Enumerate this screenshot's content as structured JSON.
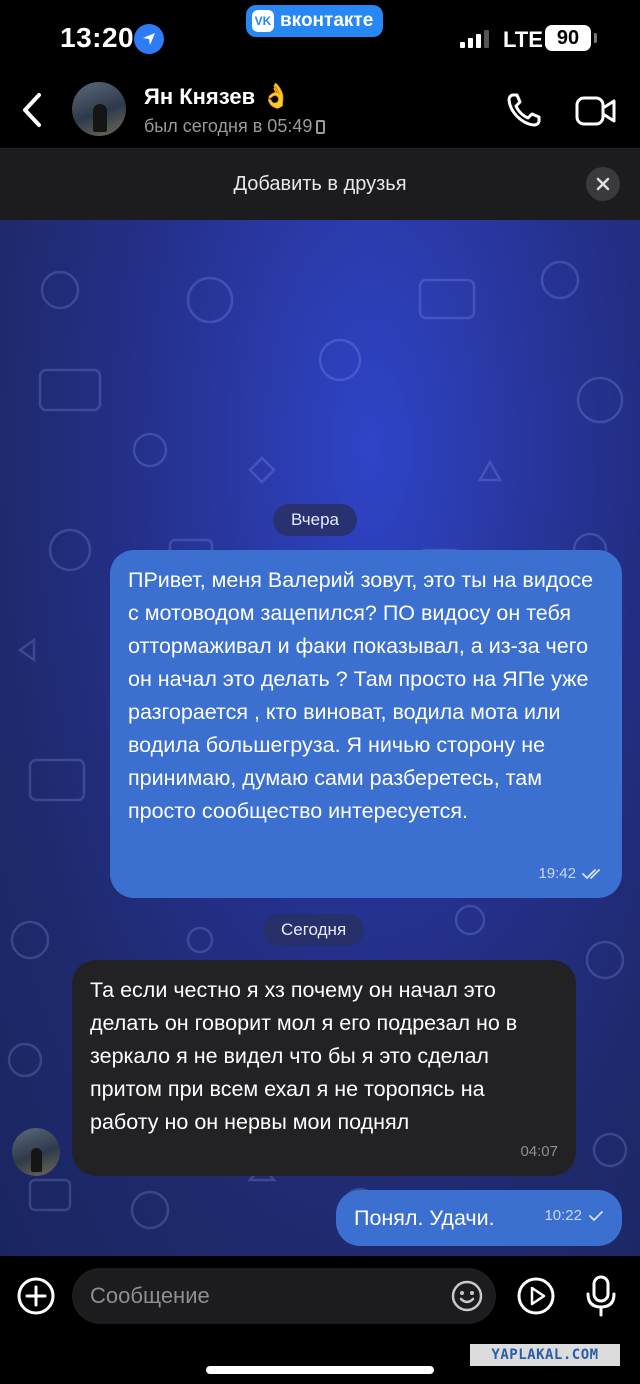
{
  "status_bar": {
    "time": "13:20",
    "app_badge": "вконтакте",
    "app_badge_logo": "VK",
    "network": "LTE",
    "battery": "90"
  },
  "header": {
    "name": "Ян Князев",
    "name_emoji": "👌",
    "last_seen": "был сегодня в 05:49"
  },
  "friend_bar": {
    "label": "Добавить в друзья"
  },
  "messages": [
    {
      "type": "date",
      "label": "Вчера"
    },
    {
      "type": "outgoing",
      "text": "ПРивет, меня Валерий зовут, это ты на видосе с мотоводом зацепился? ПО видосу он тебя оттормаживал и факи показывал, а из-за чего он начал это делать ? Там просто на ЯПе уже разгорается , кто виноват, водила мота или водила большегруза. Я ничью сторону не принимаю, думаю сами разберетесь, там просто сообщество интересуется.",
      "time": "19:42",
      "status": "read"
    },
    {
      "type": "date",
      "label": "Сегодня"
    },
    {
      "type": "incoming",
      "text": "Та если честно я хз почему он начал это делать он говорит мол я его подрезал но в зеркало я не видел что бы я это сделал притом при всем ехал я не торопясь на работу но он нервы мои поднял",
      "time": "04:07"
    },
    {
      "type": "outgoing",
      "text": "Понял. Удачи.",
      "time": "10:22",
      "status": "sent"
    }
  ],
  "input_bar": {
    "placeholder": "Сообщение"
  },
  "watermark": "YAPLAKAL.COM",
  "colors": {
    "outgoing_bubble": "#3b6fd0",
    "incoming_bubble": "#222224",
    "accent": "#2787f5",
    "chat_bg": "#24308a"
  }
}
